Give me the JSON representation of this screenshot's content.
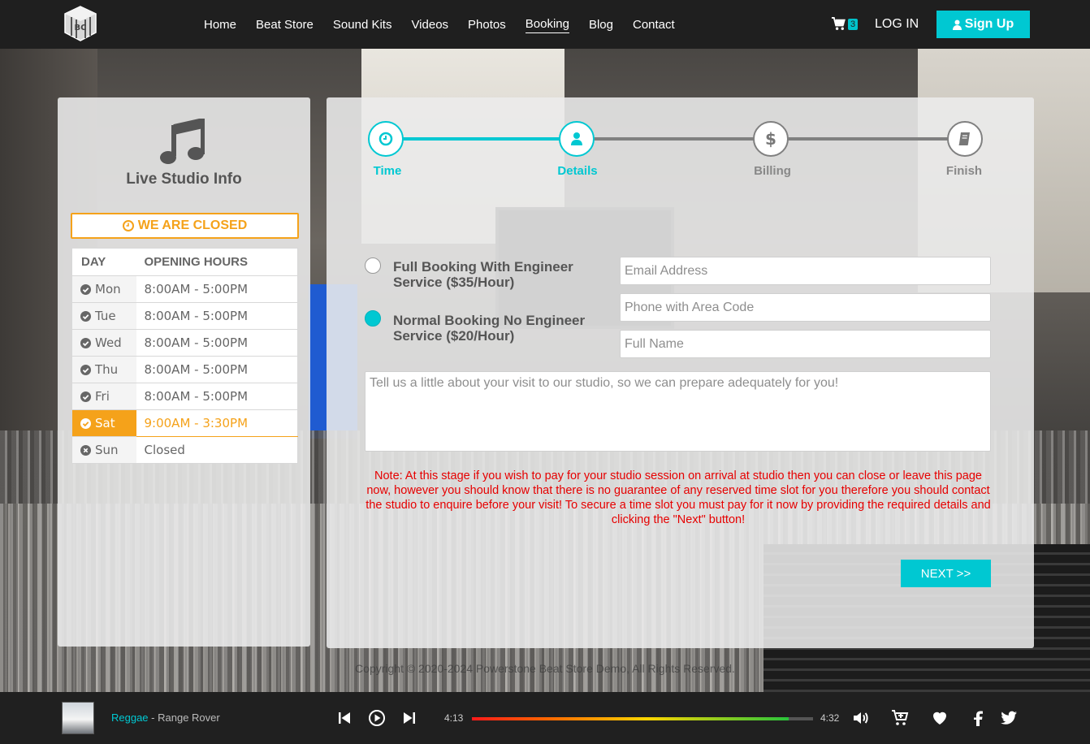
{
  "header": {
    "nav": [
      "Home",
      "Beat Store",
      "Sound Kits",
      "Videos",
      "Photos",
      "Booking",
      "Blog",
      "Contact"
    ],
    "active_nav": "Booking",
    "cart_count": "3",
    "login_label": "LOG IN",
    "signup_label": "Sign Up"
  },
  "studio": {
    "title": "Live Studio Info",
    "status": "WE ARE CLOSED",
    "status_color": "#f5a21a",
    "table_headers": [
      "DAY",
      "OPENING HOURS"
    ],
    "hours": [
      {
        "day": "Mon",
        "time": "8:00AM - 5:00PM",
        "open": true
      },
      {
        "day": "Tue",
        "time": "8:00AM - 5:00PM",
        "open": true
      },
      {
        "day": "Wed",
        "time": "8:00AM - 5:00PM",
        "open": true
      },
      {
        "day": "Thu",
        "time": "8:00AM - 5:00PM",
        "open": true
      },
      {
        "day": "Fri",
        "time": "8:00AM - 5:00PM",
        "open": true
      },
      {
        "day": "Sat",
        "time": "9:00AM - 3:30PM",
        "open": true,
        "today": true
      },
      {
        "day": "Sun",
        "time": "Closed",
        "open": false
      }
    ]
  },
  "booking": {
    "steps": [
      {
        "label": "Time",
        "icon": "clock-icon",
        "done": true
      },
      {
        "label": "Details",
        "icon": "user-icon",
        "done": true
      },
      {
        "label": "Billing",
        "icon": "dollar-icon",
        "done": false
      },
      {
        "label": "Finish",
        "icon": "book-icon",
        "done": false
      }
    ],
    "options": [
      {
        "label": "Full Booking With Engineer Service ($35/Hour)",
        "checked": false
      },
      {
        "label": "Normal Booking No Engineer Service ($20/Hour)",
        "checked": true
      }
    ],
    "email_placeholder": "Email Address",
    "phone_placeholder": "Phone with Area Code",
    "name_placeholder": "Full Name",
    "message_placeholder": "Tell us a little about your visit to our studio, so we can prepare adequately for you!",
    "note": "Note: At this stage if you wish to pay for your studio session on arrival at studio then you can close or leave this page now, however you should know that there is no guarantee of any reserved time slot for you therefore you should contact the studio to enquire before your visit! To secure a time slot you must pay for it now by providing the required details and clicking the \"Next\" button!",
    "next_label": "NEXT >>",
    "accent_color": "#00c8d2"
  },
  "footer": {
    "copyright": "Copyright © 2020-2024 Powerstone Beat Store Demo, All Rights Reserved."
  },
  "player": {
    "genre": "Reggae",
    "separator": " - ",
    "title": "Range Rover",
    "elapsed": "4:13",
    "duration": "4:32",
    "progress_fraction": 0.929
  }
}
